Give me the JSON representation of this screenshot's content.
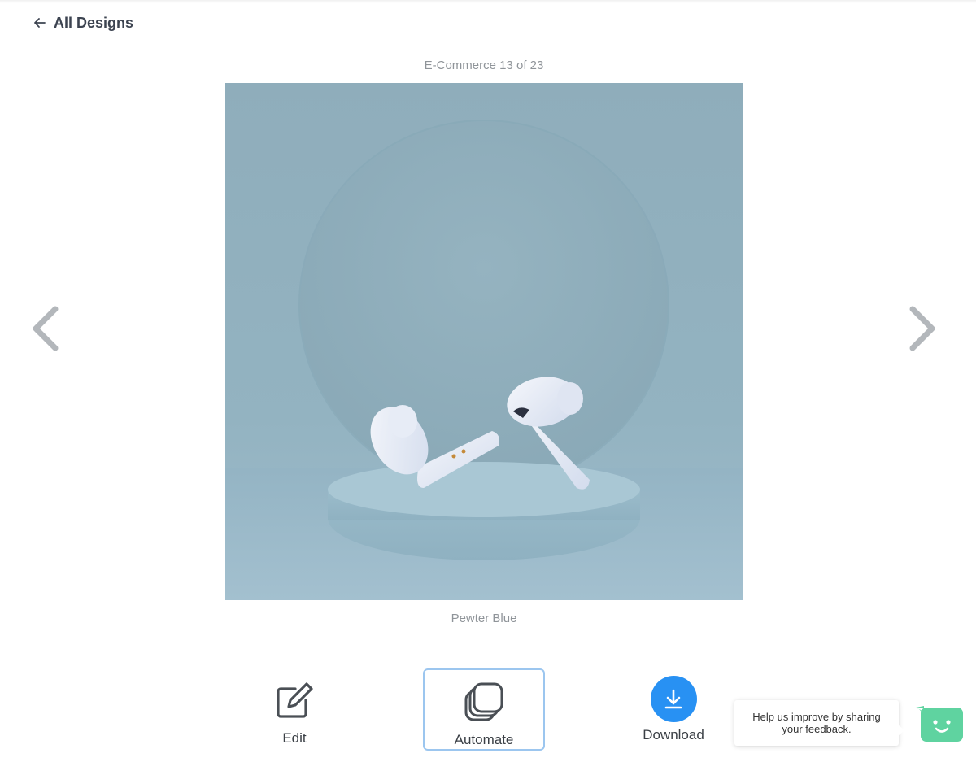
{
  "nav": {
    "back_label": "All Designs",
    "back_icon": "arrow-left-icon"
  },
  "gallery": {
    "counter": "E-Commerce 13 of 23",
    "caption": "Pewter Blue",
    "prev_icon": "chevron-left-icon",
    "next_icon": "chevron-right-icon"
  },
  "actions": {
    "edit_label": "Edit",
    "automate_label": "Automate",
    "download_label": "Download",
    "accent_color": "#2891f3",
    "selected_border_color": "#9cc6ef"
  },
  "feedback": {
    "line1": "Help us improve by sharing",
    "line2": "your feedback.",
    "bot_color": "#5fd3a0"
  }
}
